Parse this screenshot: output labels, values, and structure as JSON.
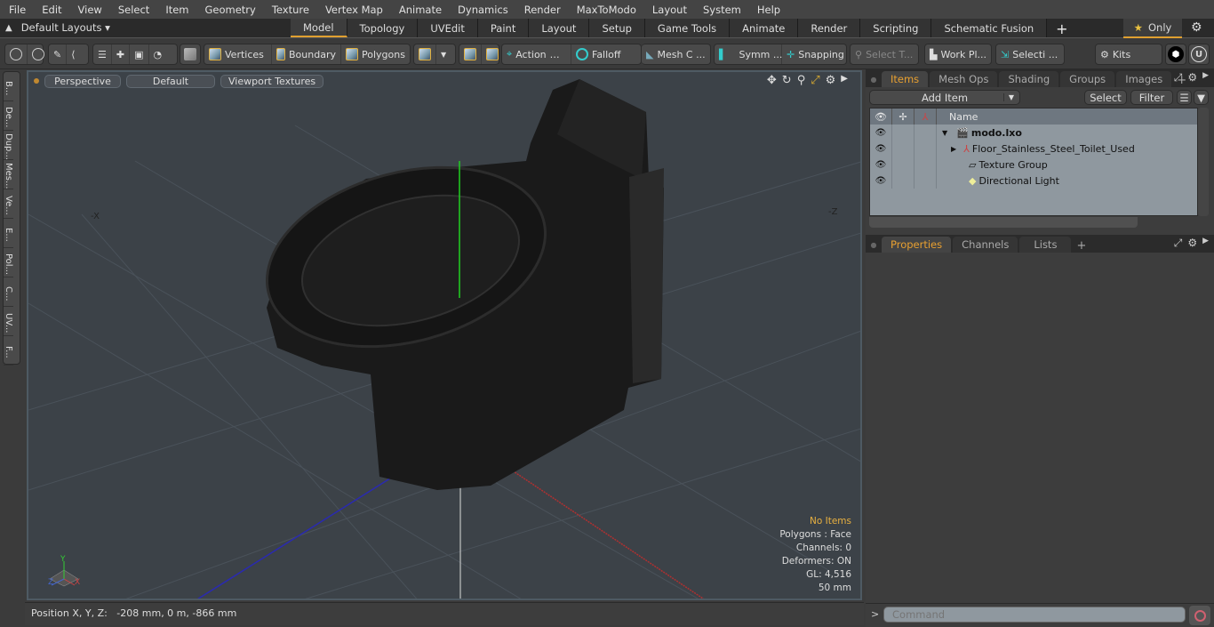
{
  "menu": [
    "File",
    "Edit",
    "View",
    "Select",
    "Item",
    "Geometry",
    "Texture",
    "Vertex Map",
    "Animate",
    "Dynamics",
    "Render",
    "MaxToModo",
    "Layout",
    "System",
    "Help"
  ],
  "layouts_label": "Default Layouts ▾",
  "mode_tabs": [
    "Model",
    "Topology",
    "UVEdit",
    "Paint",
    "Layout",
    "Setup",
    "Game Tools",
    "Animate",
    "Render",
    "Scripting",
    "Schematic Fusion"
  ],
  "active_mode_tab": "Model",
  "only_label": "Only",
  "toolbar": {
    "vertices": "Vertices",
    "boundary": "Boundary",
    "polygons": "Polygons",
    "action": "Action",
    "falloff": "Falloff",
    "mesh_c": "Mesh C ...",
    "symm": "Symm ...",
    "snapping": "Snapping",
    "select_t": "Select T...",
    "work_pl": "Work Pl...",
    "selecti": "Selecti ...",
    "kits": "Kits"
  },
  "left_tabs": [
    "B...",
    "De...",
    "Dup...",
    "Mes...",
    "Ve...",
    "E...",
    "Pol...",
    "C...",
    "UV...",
    "F..."
  ],
  "viewport": {
    "view": "Perspective",
    "shading": "Default",
    "textures": "Viewport Textures",
    "info": {
      "selection": "No Items",
      "polygons": "Polygons : Face",
      "channels": "Channels: 0",
      "deformers": "Deformers: ON",
      "gl": "GL: 4,516",
      "scale": "50 mm"
    },
    "axis_labels": {
      "neg_x": "-X",
      "neg_z": "-Z"
    }
  },
  "status_bar": "Position X, Y, Z:   -208 mm, 0 m, -866 mm",
  "items_panel": {
    "tabs": [
      "Items",
      "Mesh Ops",
      "Shading",
      "Groups",
      "Images"
    ],
    "active_tab": "Items",
    "add_item": "Add Item",
    "select": "Select",
    "filter": "Filter",
    "name_header": "Name",
    "rows": [
      {
        "name": "modo.lxo",
        "bold": true
      },
      {
        "name": "Floor_Stainless_Steel_Toilet_Used"
      },
      {
        "name": "Texture Group"
      },
      {
        "name": "Directional Light"
      }
    ]
  },
  "properties_panel": {
    "tabs": [
      "Properties",
      "Channels",
      "Lists"
    ],
    "active_tab": "Properties"
  },
  "command_placeholder": "Command",
  "colors": {
    "accent": "#e0a030",
    "viewport_bg": "#3c4248",
    "tree_bg": "#8f989f"
  }
}
